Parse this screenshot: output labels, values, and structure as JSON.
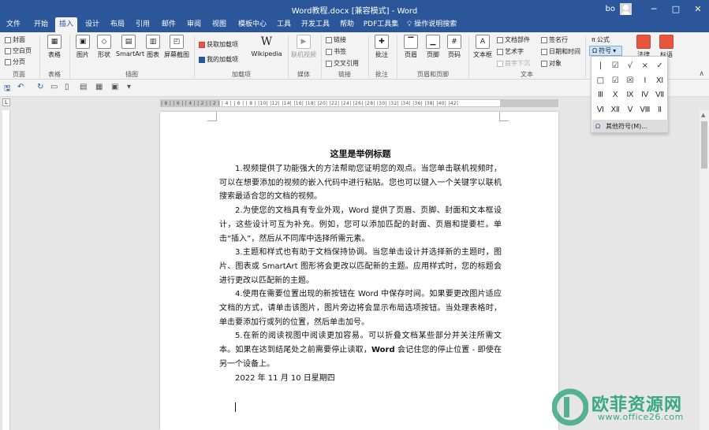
{
  "window": {
    "title": "Word教程.docx [兼容模式] - Word",
    "user": "bo",
    "controls": [
      "─",
      "□",
      "✕"
    ]
  },
  "tabs": [
    "文件",
    "开始",
    "插入",
    "设计",
    "布局",
    "引用",
    "邮件",
    "审阅",
    "视图",
    "模板中心",
    "工具",
    "开发工具",
    "帮助",
    "PDF工具集",
    "操作说明搜索"
  ],
  "ribbon": {
    "groups": {
      "pages": {
        "label": "页面",
        "cover": "封面",
        "blank": "空白页",
        "pagebreak": "分页"
      },
      "tables": {
        "label": "表格",
        "table": "表格"
      },
      "illustrations": {
        "label": "插图",
        "picture": "图片",
        "shapes": "形状",
        "smartart": "SmartArt",
        "chart": "图表",
        "screenshot": "屏幕截图"
      },
      "addins": {
        "label": "加载项",
        "get": "获取加载项",
        "mine": "我的加载项",
        "wikipedia": "Wikipedia"
      },
      "media": {
        "label": "媒体",
        "video": "联机视频"
      },
      "links": {
        "label": "链接",
        "link": "链接",
        "bookmark": "书签",
        "crossref": "交叉引用"
      },
      "comments": {
        "label": "批注",
        "comment": "批注"
      },
      "headerfooter": {
        "label": "页眉和页脚",
        "header": "页眉",
        "footer": "页脚",
        "pagenum": "页码"
      },
      "text": {
        "label": "文本",
        "textbox": "文本框",
        "docparts": "文档部件",
        "wordart": "艺术字",
        "dropcap": "首字下沉",
        "signature": "签名行",
        "datetime": "日期和时间",
        "object": "对象"
      },
      "symbols": {
        "equation": "公式",
        "symbol": "符号",
        "law": "法律",
        "slogan": "标语"
      }
    }
  },
  "symbol_panel": {
    "symbols": [
      "|",
      "☑",
      "√",
      "×",
      "✓",
      "□",
      "☑",
      "☒",
      "Ⅰ",
      "Ⅺ",
      "Ⅲ",
      "Ⅹ",
      "Ⅸ",
      "Ⅳ",
      "Ⅶ",
      "Ⅵ",
      "Ⅻ",
      "Ⅴ",
      "Ⅷ",
      "Ⅱ"
    ],
    "more": "其他符号(M)..."
  },
  "ruler": {
    "marks": "| 8 | | 6 | | 4 | | 2 | | 2 | | 4 | | 6 | | 8 | |10| |12| |14| |16| |18| |20| |22| |24| |26| |28| |30| |32| |34| |36| |38| |40| |42|"
  },
  "document": {
    "title": "这里是举例标题",
    "paragraphs": [
      "1.视频提供了功能强大的方法帮助您证明您的观点。当您单击联机视频时，可以在想要添加的视频的嵌入代码中进行粘贴。您也可以键入一个关键字以联机搜索最适合您的文档的视频。",
      "2.为使您的文档具有专业外观，Word 提供了页眉、页脚、封面和文本框设计，这些设计可互为补充。例如，您可以添加匹配的封面、页眉和提要栏。单击“插入”，然后从不同库中选择所需元素。",
      "3.主题和样式也有助于文档保持协调。当您单击设计并选择新的主题时，图片、图表或 SmartArt 图形将会更改以匹配新的主题。应用样式时，您的标题会进行更改以匹配新的主题。",
      "4.使用在需要位置出现的新按钮在 Word 中保存时间。如果要更改图片适应文档的方式，请单击该图片，图片旁边将会显示布局选项按钮。当处理表格时，单击要添加行或列的位置，然后单击加号。"
    ],
    "p5_start": "5.在新的阅读视图中阅读更加容易。可以折叠文档某些部分并关注所需文本。如果在达到结尾处之前需要停止读取，",
    "p5_bold": "Word",
    "p5_end": " 会记住您的停止位置 - 即使在另一个设备上。",
    "date": "2022 年 11 月 10 日星期四"
  },
  "watermark": {
    "text": "欧菲资源网",
    "url": "www.office26.com"
  },
  "colors": {
    "accent": "#2b579a",
    "watermark": "#3aa882"
  }
}
